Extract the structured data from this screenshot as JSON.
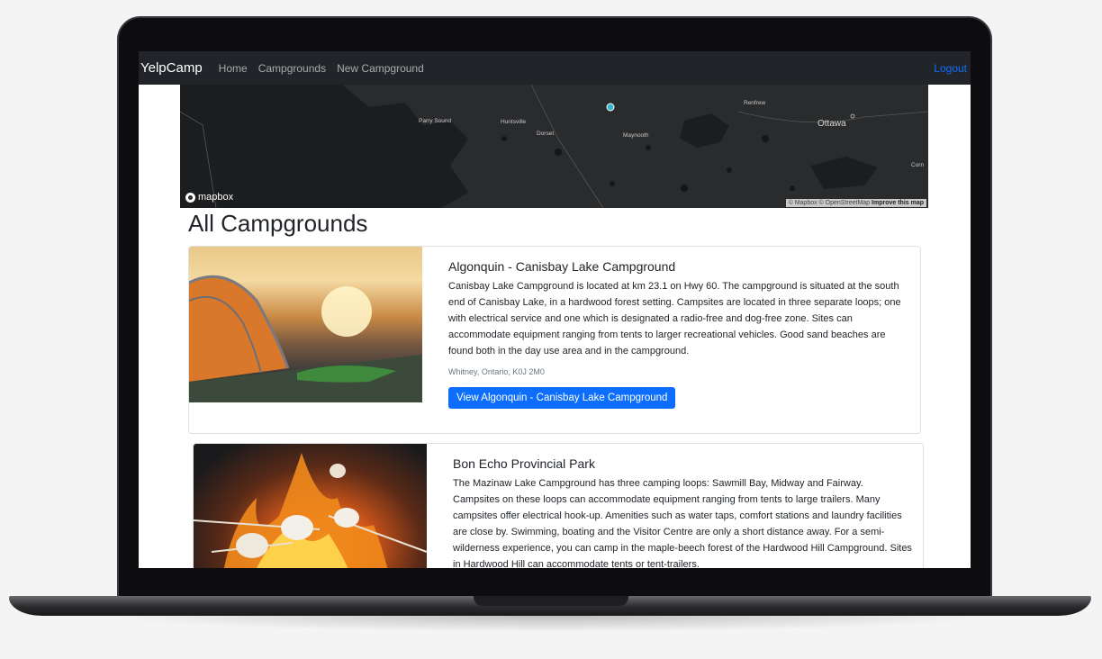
{
  "navbar": {
    "brand": "YelpCamp",
    "links": [
      "Home",
      "Campgrounds",
      "New Campground"
    ],
    "logout": "Logout"
  },
  "map": {
    "logo": "mapbox",
    "labels": [
      "Parry Sound",
      "Huntsville",
      "Dorset",
      "Maynooth",
      "Renfrew",
      "Ottawa",
      "Corn"
    ],
    "attribution": "© Mapbox © OpenStreetMap",
    "improve": "Improve this map"
  },
  "page": {
    "title": "All Campgrounds"
  },
  "campgrounds": [
    {
      "title": "Algonquin - Canisbay Lake Campground",
      "description": "Canisbay Lake Campground is located at km 23.1 on Hwy 60. The campground is situated at the south end of Canisbay Lake, in a hardwood forest setting. Campsites are located in three separate loops; one with electrical service and one which is designated a radio-free and dog-free zone. Sites can accommodate equipment ranging from tents to larger recreational vehicles. Good sand beaches are found both in the day use area and in the campground.",
      "location": "Whitney, Ontario, K0J 2M0",
      "button": "View Algonquin - Canisbay Lake Campground"
    },
    {
      "title": "Bon Echo Provincial Park",
      "description": "The Mazinaw Lake Campground has three camping loops: Sawmill Bay, Midway and Fairway. Campsites on these loops can accommodate equipment ranging from tents to large trailers. Many campsites offer electrical hook-up. Amenities such as water taps, comfort stations and laundry facilities are close by. Swimming, boating and the Visitor Centre are only a short distance away. For a semi-wilderness experience, you can camp in the maple-beech forest of the Hardwood Hill Campground. Sites in Hardwood Hill can accommodate tents or tent-trailers."
    }
  ],
  "colors": {
    "navbar_bg": "#212529",
    "primary": "#0d6efd",
    "map_bg": "#2a2b2d",
    "marker": "#3bb2d0"
  }
}
